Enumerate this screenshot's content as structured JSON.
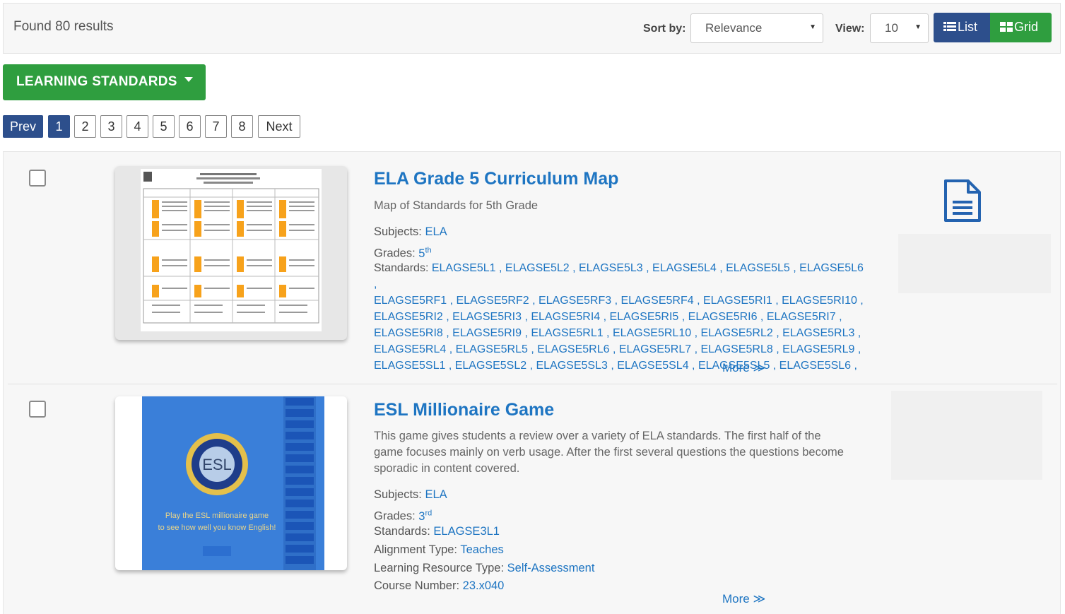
{
  "header": {
    "found_text": "Found 80 results",
    "sort_label": "Sort by:",
    "sort_value": "Relevance",
    "view_label": "View:",
    "view_value": "10",
    "list_label": "List",
    "grid_label": "Grid"
  },
  "filter": {
    "learning_standards_label": "LEARNING STANDARDS"
  },
  "pagination": {
    "prev": "Prev",
    "pages": [
      "1",
      "2",
      "3",
      "4",
      "5",
      "6",
      "7",
      "8"
    ],
    "current": "1",
    "next": "Next"
  },
  "results": [
    {
      "title": "ELA Grade 5 Curriculum Map",
      "description": "Map of Standards for 5th Grade",
      "subjects_label": "Subjects:",
      "subjects": "ELA",
      "grades_label": "Grades:",
      "grade_num": "5",
      "grade_suffix": "th",
      "standards_label": "Standards:",
      "standards_lines": [
        "ELAGSE5L1 , ELAGSE5L2 , ELAGSE5L3 , ELAGSE5L4 , ELAGSE5L5 , ELAGSE5L6 ,",
        "ELAGSE5RF1 , ELAGSE5RF2 , ELAGSE5RF3 , ELAGSE5RF4 , ELAGSE5RI1 , ELAGSE5RI10 ,",
        "ELAGSE5RI2 , ELAGSE5RI3 , ELAGSE5RI4 , ELAGSE5RI5 , ELAGSE5RI6 , ELAGSE5RI7 ,",
        "ELAGSE5RI8 , ELAGSE5RI9 , ELAGSE5RL1 , ELAGSE5RL10 , ELAGSE5RL2 , ELAGSE5RL3 ,",
        "ELAGSE5RL4 , ELAGSE5RL5 , ELAGSE5RL6 , ELAGSE5RL7 , ELAGSE5RL8 , ELAGSE5RL9 ,",
        "ELAGSE5SL1 , ELAGSE5SL2 , ELAGSE5SL3 , ELAGSE5SL4 , ELAGSE5SL5 , ELAGSE5SL6 ,"
      ],
      "more": "More ≫",
      "icon": "document-icon"
    },
    {
      "title": "ESL Millionaire Game",
      "description": "This game gives students a review over a variety of ELA standards. The first half of the game focuses mainly on verb usage. After the first several questions the questions become sporadic in content covered.",
      "subjects_label": "Subjects:",
      "subjects": "ELA",
      "grades_label": "Grades:",
      "grade_num": "3",
      "grade_suffix": "rd",
      "standards_label": "Standards:",
      "standards": "ELAGSE3L1",
      "alignment_label": "Alignment Type:",
      "alignment": "Teaches",
      "resource_label": "Learning Resource Type:",
      "resource": "Self-Assessment",
      "course_label": "Course Number:",
      "course": "23.x040",
      "more": "More ≫",
      "thumb_badge": "ESL",
      "thumb_caption_1": "Play the ESL millionaire game",
      "thumb_caption_2": "to see how well you know English!"
    }
  ],
  "colors": {
    "primary_blue": "#2d4f8c",
    "green": "#2f9e3f",
    "link": "#1e75c2"
  }
}
